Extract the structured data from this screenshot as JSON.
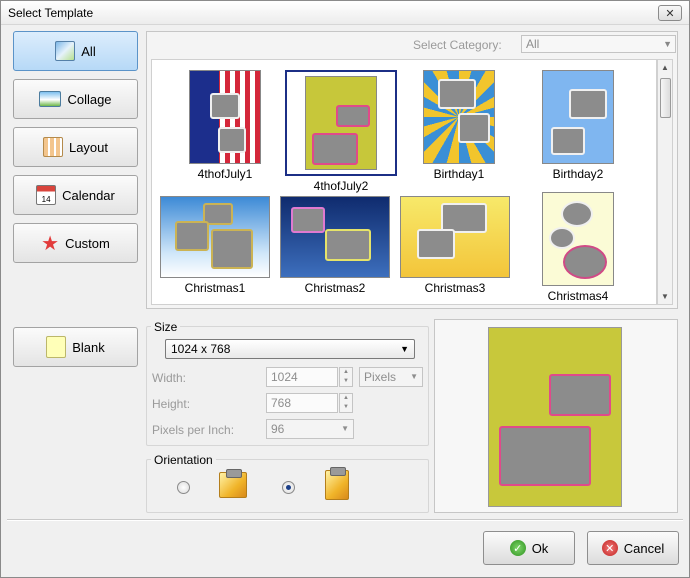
{
  "window": {
    "title": "Select Template",
    "close_glyph": "✕"
  },
  "sidebar": {
    "items": [
      {
        "label": "All",
        "icon": "picture-icon",
        "active": true
      },
      {
        "label": "Collage",
        "icon": "landscape-icon",
        "active": false
      },
      {
        "label": "Layout",
        "icon": "layout-grid-icon",
        "active": false
      },
      {
        "label": "Calendar",
        "icon": "calendar-icon",
        "active": false
      },
      {
        "label": "Custom",
        "icon": "star-icon",
        "active": false
      }
    ],
    "blank": {
      "label": "Blank",
      "icon": "blank-page-icon"
    }
  },
  "category": {
    "label": "Select Category:",
    "value": "All"
  },
  "templates": [
    {
      "name": "4thofJuly1",
      "selected": false
    },
    {
      "name": "4thofJuly2",
      "selected": true
    },
    {
      "name": "Birthday1",
      "selected": false
    },
    {
      "name": "Birthday2",
      "selected": false
    },
    {
      "name": "Christmas1",
      "selected": false
    },
    {
      "name": "Christmas2",
      "selected": false
    },
    {
      "name": "Christmas3",
      "selected": false
    },
    {
      "name": "Christmas4",
      "selected": false
    }
  ],
  "size": {
    "title": "Size",
    "preset": "1024 x 768",
    "width_label": "Width:",
    "width_value": "1024",
    "height_label": "Height:",
    "height_value": "768",
    "ppi_label": "Pixels per Inch:",
    "ppi_value": "96",
    "unit": "Pixels"
  },
  "orientation": {
    "title": "Orientation",
    "selected": "portrait"
  },
  "buttons": {
    "ok": "Ok",
    "cancel": "Cancel"
  },
  "colors": {
    "accent": "#1c2f86",
    "active_button": "#b7d9f7"
  }
}
